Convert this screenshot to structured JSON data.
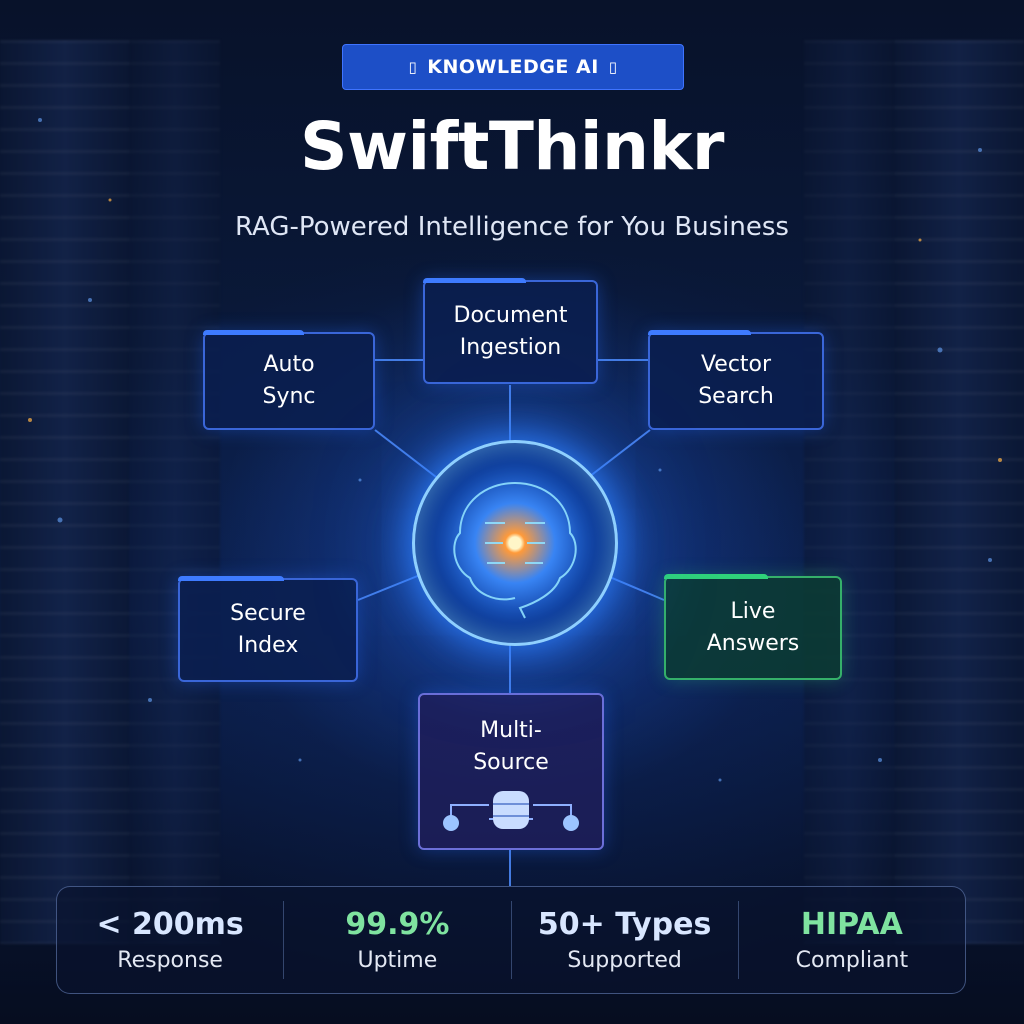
{
  "badge": {
    "icon_left": "▯",
    "label": "KNOWLEDGE AI",
    "icon_right": "▯"
  },
  "title": "SwiftThinkr",
  "subtitle": "RAG-Powered Intelligence for You Business",
  "nodes": {
    "document_ingestion": "Document\nIngestion",
    "auto_sync": "Auto\nSync",
    "vector_search": "Vector\nSearch",
    "secure_index": "Secure\nIndex",
    "live_answers": "Live\nAnswers",
    "multi_source": "Multi-\nSource"
  },
  "core_icon": "brain-circuit-icon",
  "database_icon": "database-icon",
  "stats": [
    {
      "value": "< 200ms",
      "label": "Response",
      "color": "#d8e6ff"
    },
    {
      "value": "99.9%",
      "label": "Uptime",
      "color": "#7fe3a0"
    },
    {
      "value": "50+ Types",
      "label": "Supported",
      "color": "#d8e6ff"
    },
    {
      "value": "HIPAA",
      "label": "Compliant",
      "color": "#7fe3a0"
    }
  ],
  "colors": {
    "accent": "#1d4fc7",
    "green": "#35b06a",
    "glow": "#2f80ff"
  }
}
